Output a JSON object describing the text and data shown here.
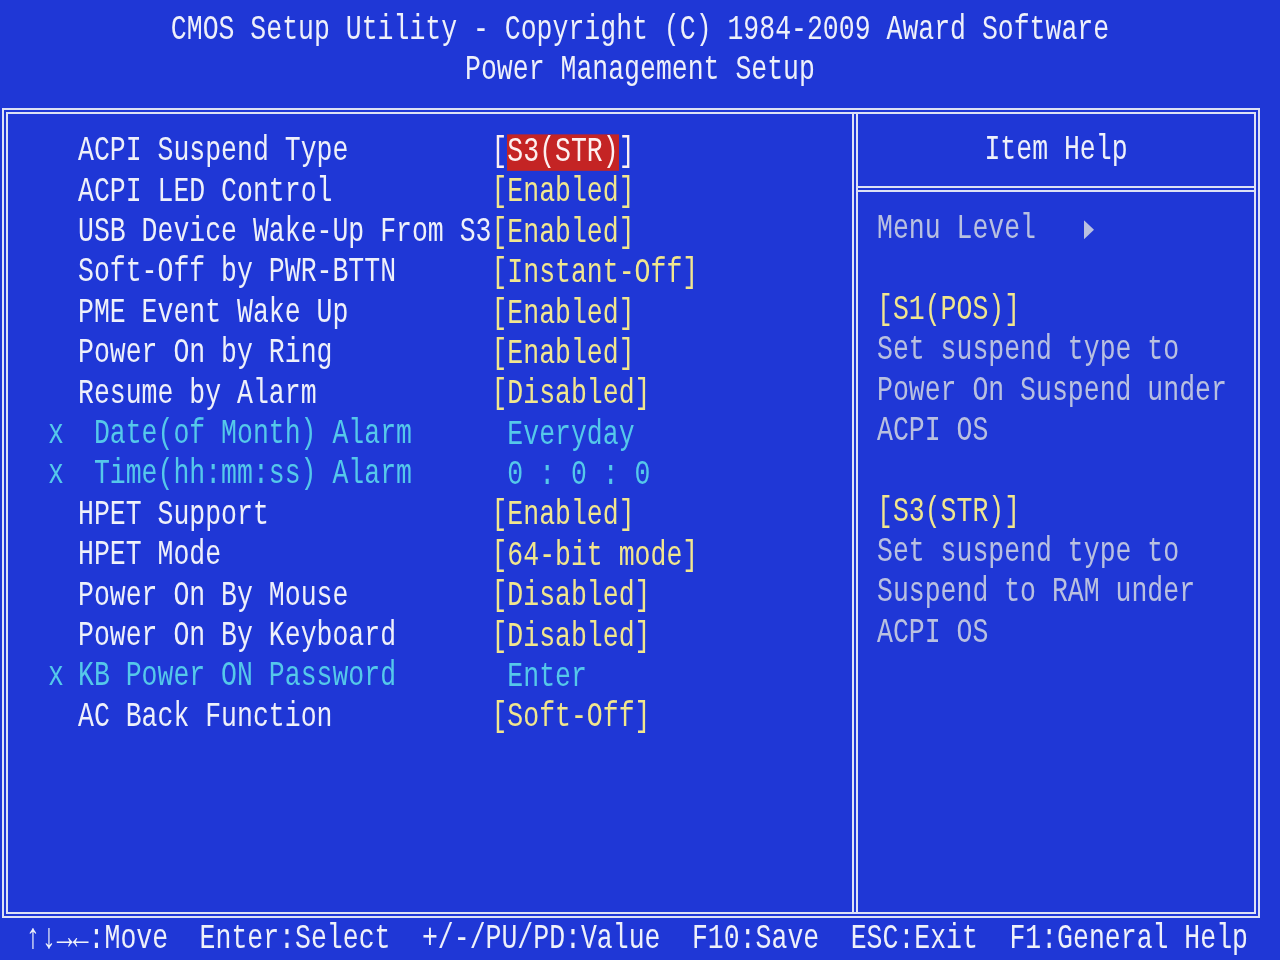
{
  "header": {
    "title": "CMOS Setup Utility - Copyright (C) 1984-2009 Award Software",
    "subtitle": "Power Management Setup"
  },
  "settings": [
    {
      "label": "ACPI Suspend Type",
      "value": "[S3(STR)]",
      "selected": true,
      "disabled": false
    },
    {
      "label": "ACPI LED Control",
      "value": "[Enabled]",
      "selected": false,
      "disabled": false
    },
    {
      "label": "USB Device Wake-Up From S3",
      "value": "[Enabled]",
      "selected": false,
      "disabled": false
    },
    {
      "label": "Soft-Off by PWR-BTTN",
      "value": "[Instant-Off]",
      "selected": false,
      "disabled": false
    },
    {
      "label": "PME Event Wake Up",
      "value": "[Enabled]",
      "selected": false,
      "disabled": false
    },
    {
      "label": "Power On by Ring",
      "value": "[Enabled]",
      "selected": false,
      "disabled": false
    },
    {
      "label": "Resume by Alarm",
      "value": "[Disabled]",
      "selected": false,
      "disabled": false,
      "children": [
        {
          "marker": "x",
          "label": "Date(of Month) Alarm",
          "value": "Everyday",
          "selected": false,
          "disabled": true
        },
        {
          "marker": "x",
          "label": "Time(hh:mm:ss) Alarm",
          "value": "0 : 0 : 0",
          "selected": false,
          "disabled": true
        }
      ]
    },
    {
      "label": "HPET Support",
      "value": "[Enabled]",
      "selected": false,
      "disabled": false
    },
    {
      "label": "HPET Mode",
      "value": "[64-bit mode]",
      "selected": false,
      "disabled": false
    },
    {
      "label": "Power On By Mouse",
      "value": "[Disabled]",
      "selected": false,
      "disabled": false
    },
    {
      "label": "Power On By Keyboard",
      "value": "[Disabled]",
      "selected": false,
      "disabled": false
    },
    {
      "marker": "x",
      "label": "KB Power ON Password",
      "value": "Enter",
      "selected": false,
      "disabled": true
    },
    {
      "label": "AC Back Function",
      "value": "[Soft-Off]",
      "selected": false,
      "disabled": false
    }
  ],
  "item_help": {
    "title": "Item Help",
    "menu_level": "Menu Level",
    "entries": [
      {
        "option": "[S1(POS)]",
        "description": "Set suspend type to Power On Suspend under ACPI OS"
      },
      {
        "option": "[S3(STR)]",
        "description": "Set suspend type to Suspend to RAM under ACPI OS"
      }
    ]
  },
  "key_hints": [
    "↑↓→←:Move",
    "Enter:Select",
    "+/-/PU/PD:Value",
    "F10:Save",
    "ESC:Exit",
    "F1:General Help"
  ]
}
